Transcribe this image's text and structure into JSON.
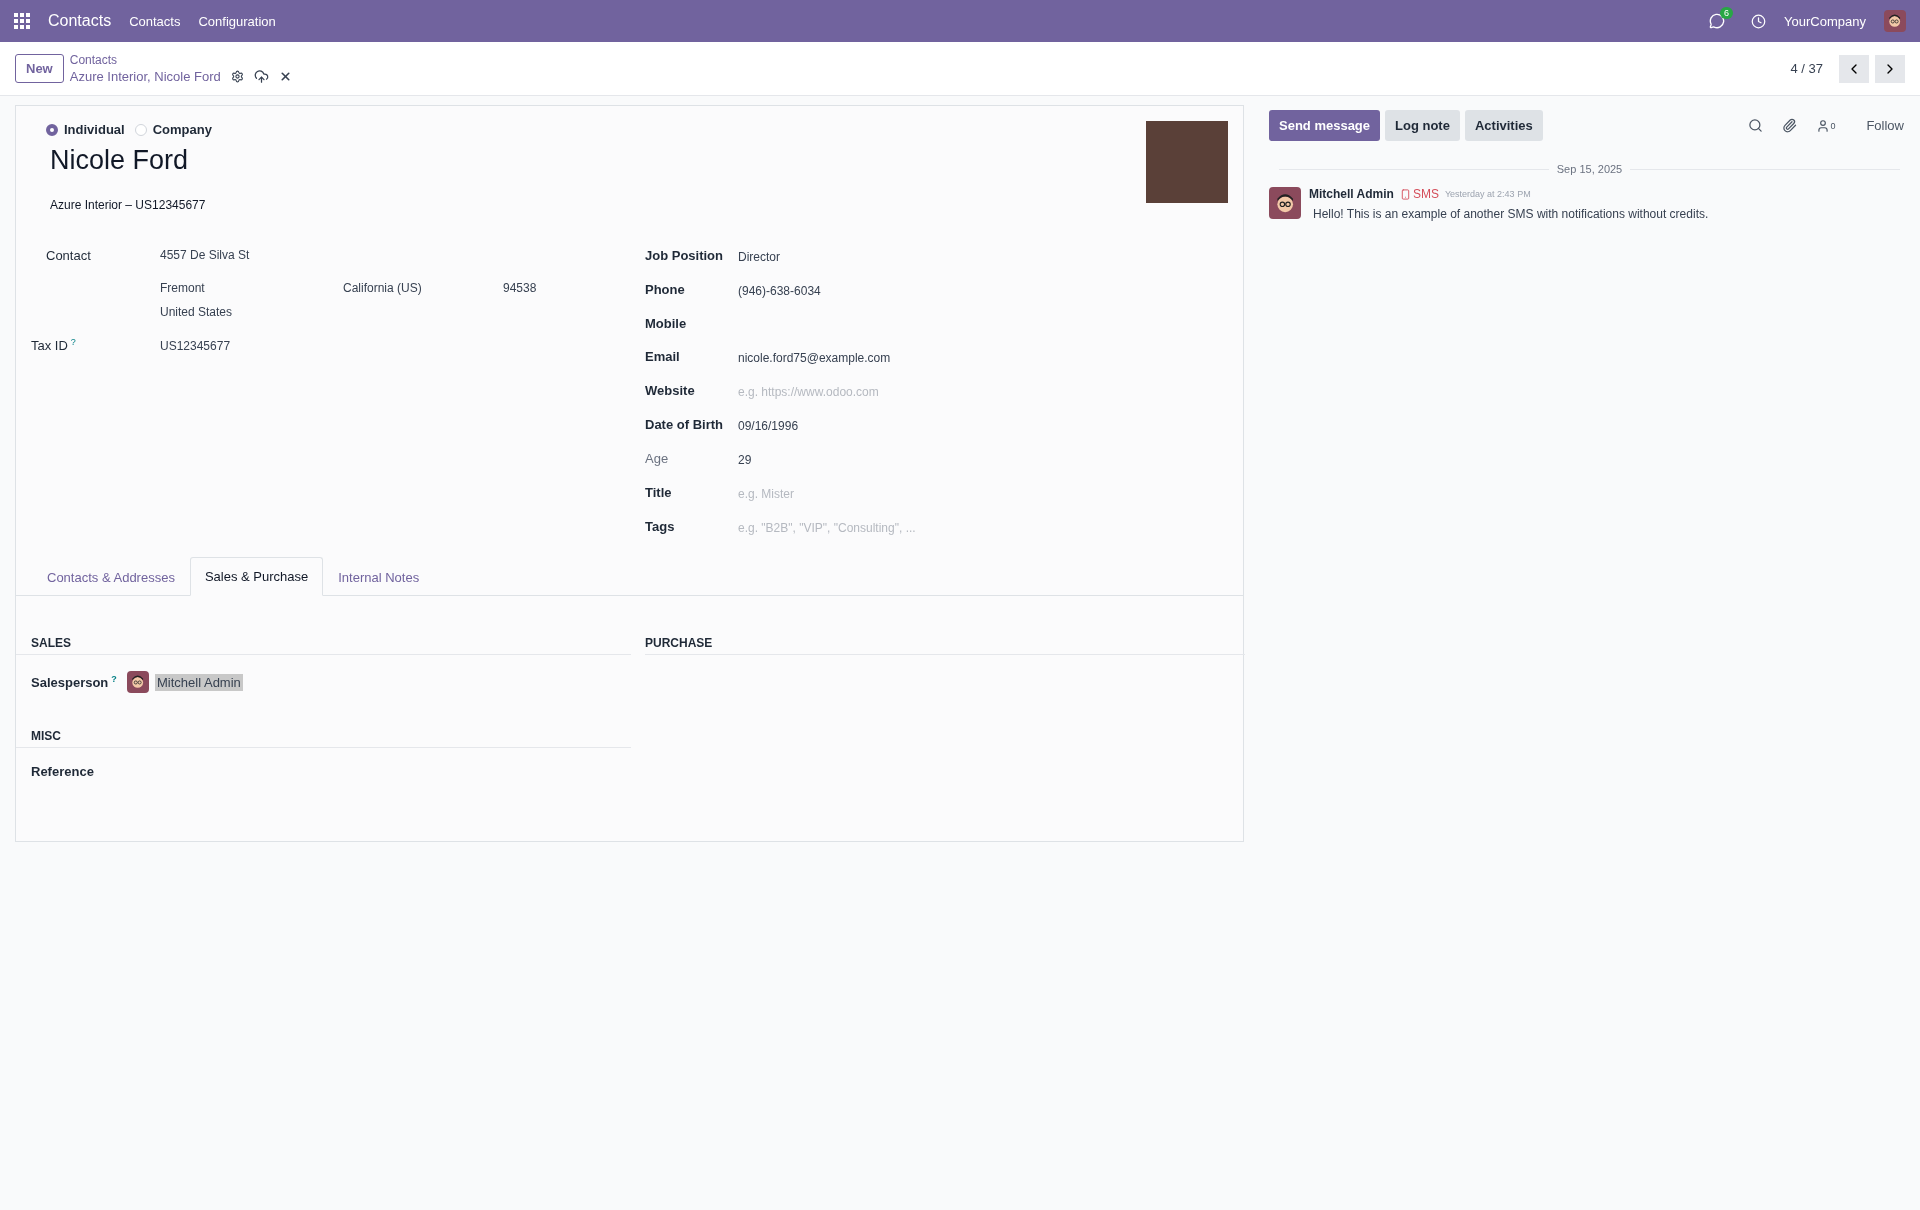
{
  "navbar": {
    "app_name": "Contacts",
    "menu": [
      "Contacts",
      "Configuration"
    ],
    "messages_badge": "6",
    "company": "YourCompany"
  },
  "control_panel": {
    "new_button": "New",
    "breadcrumb": "Contacts",
    "record_name": "Azure Interior, Nicole Ford",
    "pager": "4 / 37"
  },
  "form": {
    "company_types": [
      {
        "label": "Individual",
        "selected": true
      },
      {
        "label": "Company",
        "selected": false
      }
    ],
    "name": "Nicole Ford",
    "company_line": "Azure Interior – US12345677",
    "contact": {
      "label": "Contact",
      "street": "4557 De Silva St",
      "city": "Fremont",
      "state": "California (US)",
      "zip": "94538",
      "country": "United States"
    },
    "tax_id": {
      "label": "Tax ID",
      "help": "?",
      "value": "US12345677"
    },
    "fields": [
      {
        "label": "Job Position",
        "value": "Director",
        "readonly": false
      },
      {
        "label": "Phone",
        "value": "(946)-638-6034",
        "readonly": false
      },
      {
        "label": "Mobile",
        "readonly": false
      },
      {
        "label": "Email",
        "value": "nicole.ford75@example.com",
        "readonly": false
      },
      {
        "label": "Website",
        "placeholder": "e.g. https://www.odoo.com",
        "readonly": false
      },
      {
        "label": "Date of Birth",
        "value": "09/16/1996",
        "readonly": false
      },
      {
        "label": "Age",
        "value": "29",
        "readonly": true
      },
      {
        "label": "Title",
        "placeholder": "e.g. Mister",
        "readonly": false
      },
      {
        "label": "Tags",
        "placeholder": "e.g. \"B2B\", \"VIP\", \"Consulting\", ...",
        "readonly": false
      }
    ],
    "tabs": [
      {
        "label": "Contacts & Addresses",
        "selected": false
      },
      {
        "label": "Sales & Purchase",
        "selected": true
      },
      {
        "label": "Internal Notes",
        "selected": false
      }
    ],
    "sales": {
      "title": "SALES",
      "salesperson_label": "Salesperson",
      "help": "?",
      "salesperson": "Mitchell Admin"
    },
    "purchase": {
      "title": "PURCHASE"
    },
    "misc": {
      "title": "MISC",
      "reference_label": "Reference"
    }
  },
  "chatter": {
    "buttons": [
      {
        "label": "Send message",
        "primary": true
      },
      {
        "label": "Log note",
        "primary": false
      },
      {
        "label": "Activities",
        "primary": false
      }
    ],
    "followers_count": "0",
    "follow": "Follow",
    "date": "Sep 15, 2025",
    "message": {
      "author": "Mitchell Admin",
      "type": "SMS",
      "time": "Yesterday at 2:43 PM",
      "body": "Hello! This is an example of another SMS with notifications without credits."
    }
  }
}
